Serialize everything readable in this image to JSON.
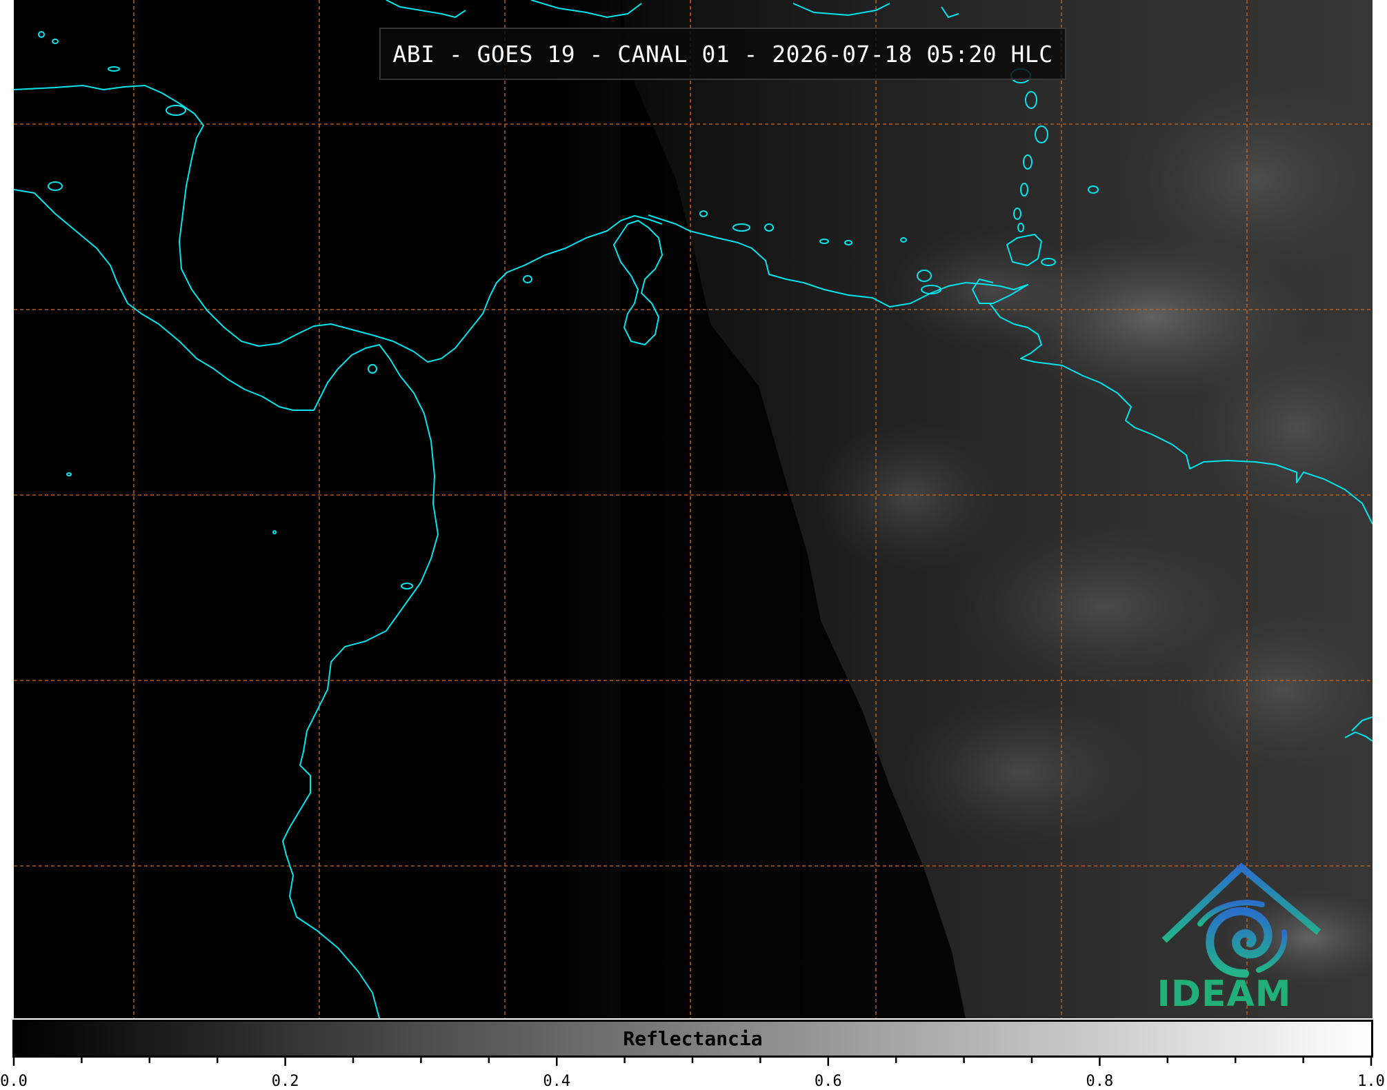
{
  "title": "ABI - GOES 19 - CANAL 01 - 2026-07-18 05:20 HLC",
  "colorbar": {
    "label": "Reflectancia",
    "min": 0.0,
    "max": 1.0,
    "tick_labels": [
      "0.0",
      "0.2",
      "0.4",
      "0.6",
      "0.8",
      "1.0"
    ],
    "colors": {
      "start": "#000000",
      "end": "#ffffff"
    }
  },
  "logo": {
    "text": "IDEAM",
    "icon": "ideam-logo-icon"
  },
  "map": {
    "coastline_color": "#00e5ee",
    "grid_color": "#d2691e",
    "grid_style": "dashed",
    "background": "#000000"
  }
}
